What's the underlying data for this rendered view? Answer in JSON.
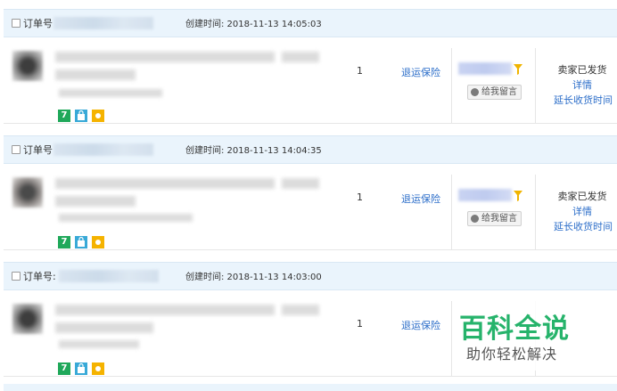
{
  "orders": [
    {
      "checkbox_label": "订单号",
      "created_text": "创建时间: 2018-11-13 14:05:03",
      "quantity": "1",
      "insurance_link": "退运保险",
      "message_button": "给我留言",
      "status": "卖家已发货",
      "detail_link": "详情",
      "extend_link": "延长收货时间"
    },
    {
      "checkbox_label": "订单号",
      "created_text": "创建时间: 2018-11-13 14:04:35",
      "quantity": "1",
      "insurance_link": "退运保险",
      "message_button": "给我留言",
      "status": "卖家已发货",
      "detail_link": "详情",
      "extend_link": "延长收货时间"
    },
    {
      "checkbox_label": "订单号:",
      "created_text": "创建时间: 2018-11-13 14:03:00",
      "quantity": "1",
      "insurance_link": "退运保险",
      "message_button": "",
      "status": "",
      "detail_link": "",
      "extend_link": ""
    }
  ],
  "badges": [
    "7"
  ],
  "watermark": {
    "title": "百科全说",
    "subtitle": "助你轻松解决"
  },
  "colors": {
    "header_bg": "#eaf4fc",
    "link": "#2c6ec9",
    "badge_green": "#1fa85a",
    "badge_blue": "#38a9d7",
    "badge_yellow": "#f5b300",
    "watermark_green": "#26b36b"
  },
  "icons": [
    "filter-icon",
    "message-icon",
    "shopping-bag-icon",
    "sun-icon"
  ]
}
